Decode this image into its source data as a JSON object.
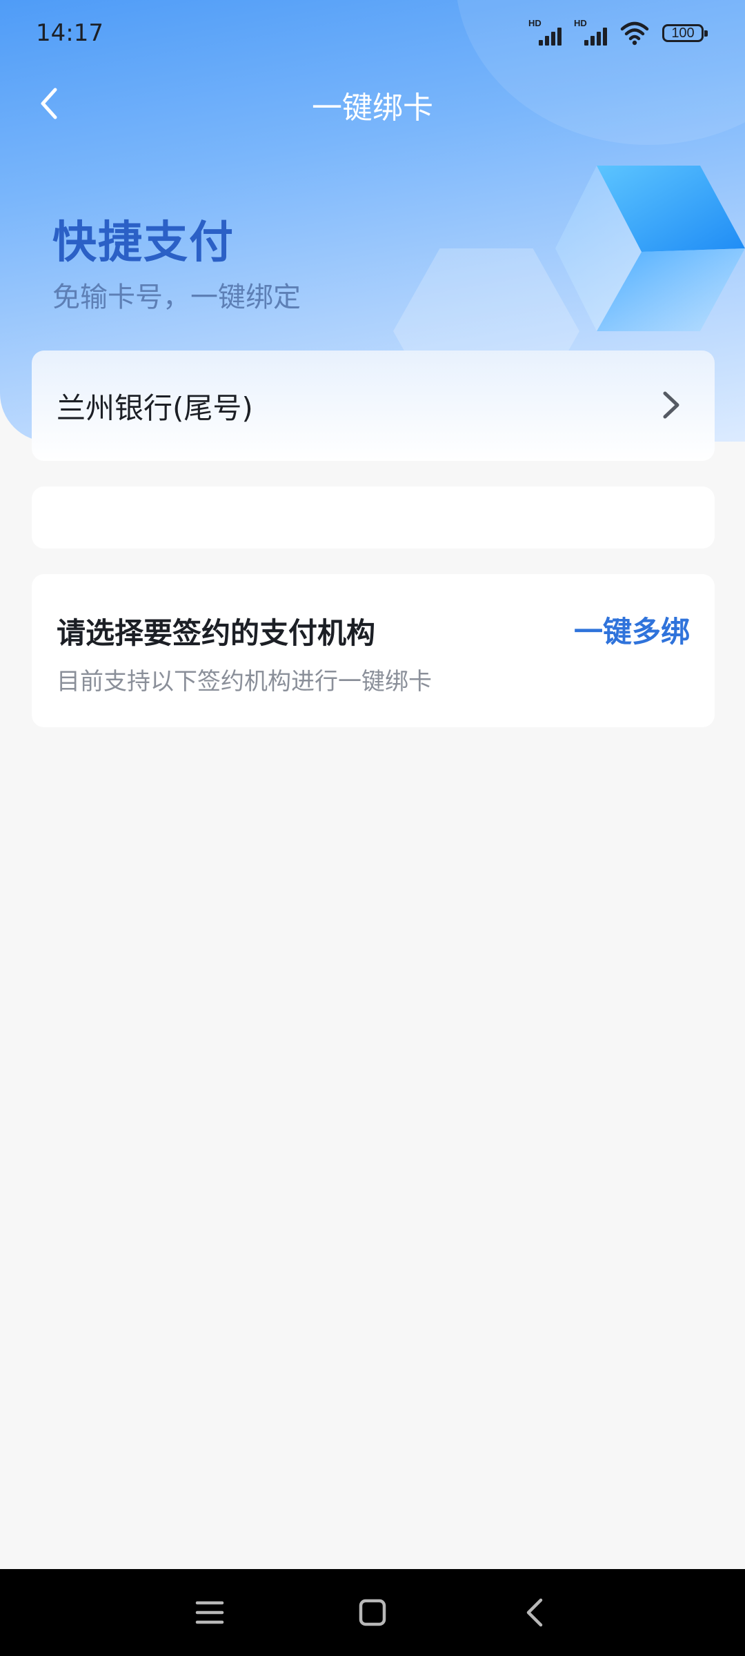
{
  "status_bar": {
    "time": "14:17",
    "signal_1_label": "HD",
    "signal_2_label": "HD",
    "battery": "100"
  },
  "header": {
    "title": "一键绑卡",
    "back_icon": "chevron-left-icon"
  },
  "hero": {
    "title": "快捷支付",
    "subtitle": "免输卡号，一键绑定"
  },
  "bank_card": {
    "label": "兰州银行(尾号)",
    "chevron_icon": "chevron-right-icon"
  },
  "org_section": {
    "title": "请选择要签约的支付机构",
    "description": "目前支持以下签约机构进行一键绑卡",
    "action_label": "一键多绑"
  },
  "system_nav": {
    "menu_icon": "menu-icon",
    "home_icon": "home-icon",
    "back_icon": "back-icon"
  },
  "colors": {
    "accent": "#2f73db",
    "hero_title": "#2b60c6",
    "page_background": "#f7f7f7"
  }
}
